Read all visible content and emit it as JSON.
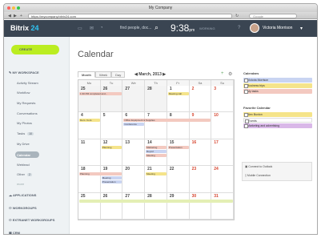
{
  "browser": {
    "title": "My Company",
    "url": "https://mycompany.bitrix24.com",
    "search_placeholder": "Google"
  },
  "header": {
    "logo_text": "Bitrix",
    "logo_num": "24",
    "search_placeholder": "find people, doc...",
    "time": "9:38",
    "time_suffix": "pm",
    "status": "WORKING",
    "user_name": "Victoria Morrison"
  },
  "sidebar": {
    "create_label": "CREATE",
    "workspace_label": "MY WORKSPACE",
    "items": [
      {
        "label": "Activity Stream",
        "count": ""
      },
      {
        "label": "Workflow",
        "count": ""
      },
      {
        "label": "My Requests",
        "count": ""
      },
      {
        "label": "Conversations",
        "count": ""
      },
      {
        "label": "My Photos",
        "count": ""
      },
      {
        "label": "Tasks",
        "count": "10"
      },
      {
        "label": "My Drive",
        "count": ""
      },
      {
        "label": "Calendar",
        "count": ""
      },
      {
        "label": "Weblead",
        "count": ""
      },
      {
        "label": "Other",
        "count": "2"
      },
      {
        "label": "more",
        "count": ""
      }
    ],
    "applications_label": "APPLICATIONS",
    "workgroups_label": "WORKGROUPS",
    "extranet_label": "EXTRANET WORKGROUPS",
    "crm_label": "CRM"
  },
  "calendar": {
    "page_title": "Calendar",
    "tabs": [
      "Month",
      "Week",
      "Day"
    ],
    "month_label": "March, 2013",
    "weekdays": [
      "Mo",
      "Tu",
      "We",
      "Th",
      "Fr",
      "Sa",
      "Su"
    ],
    "weeks": [
      [
        {
          "d": "25",
          "out": true
        },
        {
          "d": "26",
          "out": true
        },
        {
          "d": "27",
          "out": true
        },
        {
          "d": "28",
          "out": true
        },
        {
          "d": "1"
        },
        {
          "d": "2",
          "we": true
        },
        {
          "d": "3",
          "we": true
        }
      ],
      [
        {
          "d": "4"
        },
        {
          "d": "5"
        },
        {
          "d": "6"
        },
        {
          "d": "7"
        },
        {
          "d": "8"
        },
        {
          "d": "9",
          "we": true
        },
        {
          "d": "10",
          "we": true
        }
      ],
      [
        {
          "d": "11"
        },
        {
          "d": "12"
        },
        {
          "d": "13"
        },
        {
          "d": "14"
        },
        {
          "d": "15"
        },
        {
          "d": "16",
          "we": true
        },
        {
          "d": "17",
          "we": true
        }
      ],
      [
        {
          "d": "18"
        },
        {
          "d": "19"
        },
        {
          "d": "20"
        },
        {
          "d": "21"
        },
        {
          "d": "22"
        },
        {
          "d": "23",
          "we": true
        },
        {
          "d": "24",
          "we": true
        }
      ],
      [
        {
          "d": "25"
        },
        {
          "d": "26"
        },
        {
          "d": "27"
        },
        {
          "d": "28"
        },
        {
          "d": "29"
        },
        {
          "d": "30",
          "we": true
        },
        {
          "d": "31",
          "we": true
        }
      ]
    ],
    "events": [
      {
        "week": 0,
        "col": 0,
        "span": 2,
        "row": 0,
        "text": "1:30 PM completed and...",
        "color": "#f3c9c0"
      },
      {
        "week": 0,
        "col": 4,
        "span": 1,
        "row": 0,
        "text": "Meeting call",
        "color": "#f5e48a"
      },
      {
        "week": 1,
        "col": 0,
        "span": 1,
        "row": 0,
        "text": "Dem. Cont.",
        "color": "#f5e48a"
      },
      {
        "week": 1,
        "col": 2,
        "span": 4,
        "row": 0,
        "text": "Office Equipment & Supplies",
        "color": "#f3c9c0"
      },
      {
        "week": 1,
        "col": 2,
        "span": 1,
        "row": 1,
        "text": "Conference",
        "color": "#c9d4f2"
      },
      {
        "week": 2,
        "col": 1,
        "span": 1,
        "row": 0,
        "text": "Planning",
        "color": "#f5e48a"
      },
      {
        "week": 2,
        "col": 3,
        "span": 1,
        "row": 0,
        "text": "Marketing",
        "color": "#f3c9c0"
      },
      {
        "week": 2,
        "col": 3,
        "span": 1,
        "row": 1,
        "text": "Report",
        "color": "#c9d4f2"
      },
      {
        "week": 2,
        "col": 3,
        "span": 1,
        "row": 2,
        "text": "Meeting",
        "color": "#f3c9c0"
      },
      {
        "week": 2,
        "col": 4,
        "span": 1,
        "row": 0,
        "text": "Presentation",
        "color": "#f3c9c0"
      },
      {
        "week": 3,
        "col": 0,
        "span": 2,
        "row": 0,
        "text": "Planning",
        "color": "#f3c9c0"
      },
      {
        "week": 3,
        "col": 1,
        "span": 1,
        "row": 1,
        "text": "Meeting",
        "color": "#c9d4f2"
      },
      {
        "week": 3,
        "col": 1,
        "span": 1,
        "row": 2,
        "text": "Presentation",
        "color": "#c9d4f2"
      },
      {
        "week": 3,
        "col": 3,
        "span": 1,
        "row": 0,
        "text": "Meeting",
        "color": "#f5e48a"
      },
      {
        "week": 4,
        "col": 0,
        "span": 7,
        "row": 0,
        "text": "",
        "color": "#e4efb4"
      }
    ]
  },
  "right_panel": {
    "calendars_heading": "Calendars",
    "calendars": [
      {
        "label": "Victoria Morrison",
        "color": "#c9d4f2"
      },
      {
        "label": "Business trips",
        "color": "#f5e48a"
      },
      {
        "label": "My tasks",
        "color": "#f3c9c0"
      }
    ],
    "favorite_heading": "Favorite Calendar",
    "favorites": [
      {
        "label": "Alex Buxton",
        "color": "#f5e48a"
      },
      {
        "label": "Events",
        "color": "#ffffff"
      },
      {
        "label": "Marketing and advertising",
        "color": "#d9b8e8"
      }
    ],
    "outlook_label": "Connect to Outlook",
    "mobile_label": "Mobile Connection"
  }
}
